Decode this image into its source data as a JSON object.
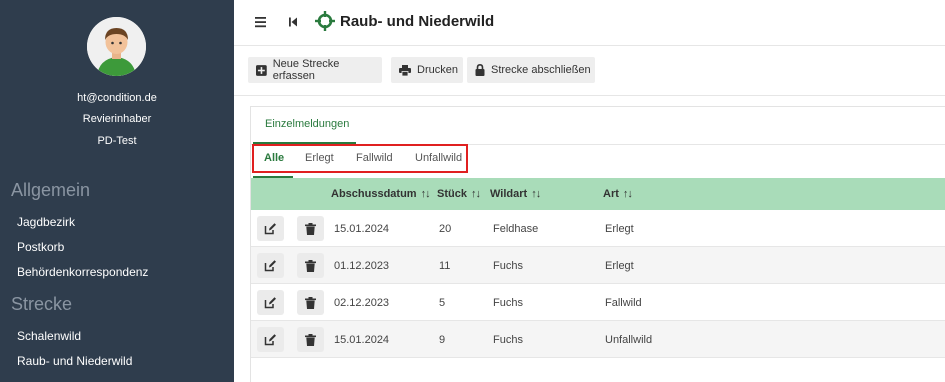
{
  "sidebar": {
    "user": {
      "email": "ht@condition.de",
      "role": "Revierinhaber",
      "org": "PD-Test"
    },
    "sections": [
      {
        "title": "Allgemein",
        "items": [
          "Jagdbezirk",
          "Postkorb",
          "Behördenkorrespondenz"
        ]
      },
      {
        "title": "Strecke",
        "items": [
          "Schalenwild",
          "Raub- und Niederwild"
        ]
      }
    ]
  },
  "header": {
    "title": "Raub- und Niederwild",
    "brand_color": "#2a7a3e"
  },
  "toolbar": {
    "new_label": "Neue Strecke erfassen",
    "print_label": "Drucken",
    "close_label": "Strecke abschließen"
  },
  "tabs": {
    "main": "Einzelmeldungen",
    "filters": [
      "Alle",
      "Erlegt",
      "Fallwild",
      "Unfallwild"
    ],
    "active_filter": "Alle"
  },
  "table": {
    "columns": [
      "Abschussdatum",
      "Stück",
      "Wildart",
      "Art"
    ],
    "sort_icon": "↑↓",
    "rows": [
      {
        "date": "15.01.2024",
        "count": "20",
        "species": "Feldhase",
        "type": "Erlegt"
      },
      {
        "date": "01.12.2023",
        "count": "11",
        "species": "Fuchs",
        "type": "Erlegt"
      },
      {
        "date": "02.12.2023",
        "count": "5",
        "species": "Fuchs",
        "type": "Fallwild"
      },
      {
        "date": "15.01.2024",
        "count": "9",
        "species": "Fuchs",
        "type": "Unfallwild"
      }
    ]
  },
  "colors": {
    "sidebar_bg": "#2f3d4d",
    "table_header": "#a9dcb9",
    "accent": "#2a7a3e",
    "highlight_box": "#e02020"
  }
}
